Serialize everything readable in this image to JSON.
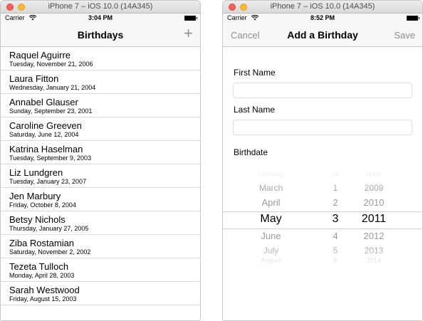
{
  "left": {
    "window_title": "iPhone 7 – iOS 10.0 (14A345)",
    "status": {
      "carrier": "Carrier",
      "time": "3:04 PM"
    },
    "nav": {
      "title": "Birthdays",
      "add_label": "+"
    },
    "birthdays": [
      {
        "name": "Raquel Aguirre",
        "date": "Tuesday, November 21, 2006"
      },
      {
        "name": "Laura Fitton",
        "date": "Wednesday, January 21, 2004"
      },
      {
        "name": "Annabel Glauser",
        "date": "Sunday, September 23, 2001"
      },
      {
        "name": "Caroline Greeven",
        "date": "Saturday, June 12, 2004"
      },
      {
        "name": "Katrina Haselman",
        "date": "Tuesday, September 9, 2003"
      },
      {
        "name": "Liz Lundgren",
        "date": "Tuesday, January 23, 2007"
      },
      {
        "name": "Jen Marbury",
        "date": "Friday, October 8, 2004"
      },
      {
        "name": "Betsy Nichols",
        "date": "Thursday, January 27, 2005"
      },
      {
        "name": "Ziba Rostamian",
        "date": "Saturday, November 2, 2002"
      },
      {
        "name": "Tezeta Tulloch",
        "date": "Monday, April 28, 2003"
      },
      {
        "name": "Sarah Westwood",
        "date": "Friday, August 15, 2003"
      }
    ]
  },
  "right": {
    "window_title": "iPhone 7 – iOS 10.0 (14A345)",
    "status": {
      "carrier": "Carrier",
      "time": "8:52 PM"
    },
    "nav": {
      "cancel_label": "Cancel",
      "title": "Add a Birthday",
      "save_label": "Save"
    },
    "form": {
      "first_name_label": "First Name",
      "first_name_value": "",
      "last_name_label": "Last Name",
      "last_name_value": "",
      "birthdate_label": "Birthdate"
    },
    "picker": {
      "months": [
        "February",
        "March",
        "April",
        "May",
        "June",
        "July",
        "August"
      ],
      "days": [
        "31",
        "1",
        "2",
        "3",
        "4",
        "5",
        "6"
      ],
      "years": [
        "2008",
        "2009",
        "2010",
        "2011",
        "2012",
        "2013",
        "2014"
      ],
      "selected": {
        "month": "May",
        "day": "3",
        "year": "2011"
      }
    }
  },
  "colors": {
    "nav_tint": "#8e8e93",
    "separator": "#d9d9dd",
    "nav_bg": "#f7f7f7"
  }
}
